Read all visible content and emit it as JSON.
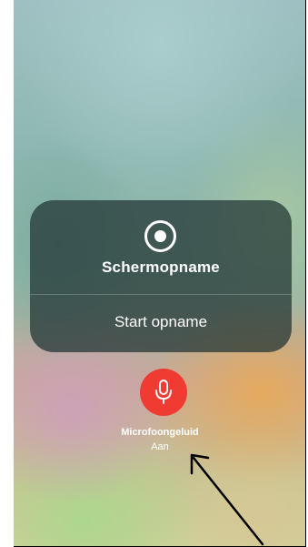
{
  "screen_recording_panel": {
    "title": "Schermopname",
    "start_label": "Start opname",
    "icon": "record-icon"
  },
  "microphone": {
    "label": "Microfoongeluid",
    "status": "Aan",
    "icon": "microphone-icon",
    "active_color": "#f03b32"
  },
  "annotation": {
    "icon": "arrow-icon",
    "color": "#000000"
  }
}
